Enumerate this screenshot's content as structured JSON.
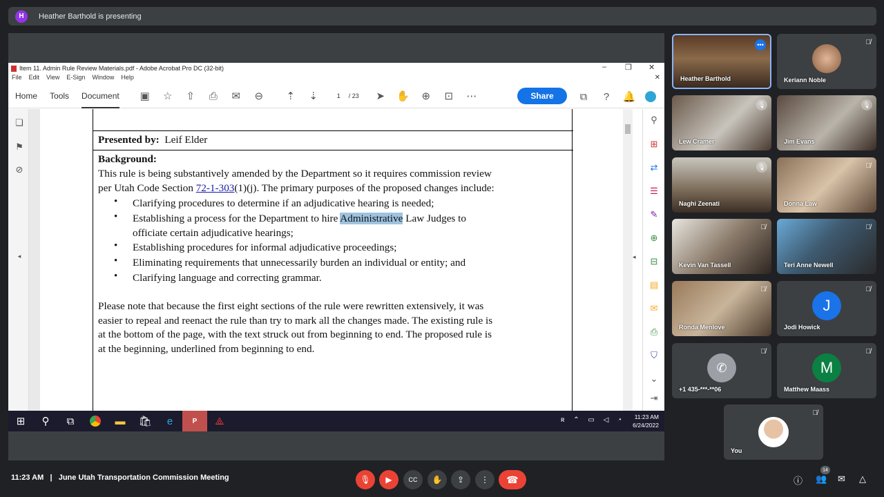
{
  "presenting_bar": {
    "avatar_letter": "H",
    "text": "Heather Barthold is presenting"
  },
  "acrobat": {
    "window_title": "Item 11. Admin Rule Review Materials.pdf - Adobe Acrobat Pro DC (32-bit)",
    "menu": [
      "File",
      "Edit",
      "View",
      "E-Sign",
      "Window",
      "Help"
    ],
    "tabs": [
      "Home",
      "Tools",
      "Document"
    ],
    "active_tab": "Document",
    "page_current": "1",
    "page_total": "/ 23",
    "share_label": "Share"
  },
  "document": {
    "presented_by_label": "Presented by:",
    "presented_by_name": "Leif Elder",
    "background_label": "Background:",
    "para1_line1": "This rule is being substantively amended by the Department so it requires commission review",
    "para1_line2_pre": "per Utah Code Section ",
    "para1_link": "72-1-303",
    "para1_line2_post": "(1)(j). The primary purposes of the proposed changes include:",
    "bullet1": "Clarifying procedures to determine if an adjudicative hearing is needed;",
    "bullet2_pre": "Establishing a process for the Department to hire ",
    "bullet2_hl": "Administrative",
    "bullet2_post": " Law Judges to",
    "bullet2_cont": "officiate certain adjudicative hearings;",
    "bullet3": "Establishing procedures for informal adjudicative proceedings;",
    "bullet4": "Eliminating requirements that unnecessarily burden an individual or entity; and",
    "bullet5": "Clarifying language and correcting grammar.",
    "para2_line1": "Please note that because the first eight sections of the rule were rewritten extensively, it was",
    "para2_line2": "easier to repeal and reenact the rule than try to mark all the changes made. The existing rule is",
    "para2_line3": "at the bottom of the page, with the text struck out from beginning to end.  The proposed rule is",
    "para2_line4": "at the beginning, underlined from beginning to end."
  },
  "taskbar": {
    "time": "11:23 AM",
    "date": "6/24/2022"
  },
  "participants": [
    {
      "name": "Heather Barthold",
      "more": "•••"
    },
    {
      "name": "Keriann Noble"
    },
    {
      "name": "Lew Cramer"
    },
    {
      "name": "Jim Evans"
    },
    {
      "name": "Naghi Zeenati"
    },
    {
      "name": "Donna Law"
    },
    {
      "name": "Kevin Van Tassell"
    },
    {
      "name": "Teri Anne Newell"
    },
    {
      "name": "Ronda Menlove"
    },
    {
      "name": "Jodi Howick",
      "initial": "J"
    },
    {
      "name": "+1 435-***-**06"
    },
    {
      "name": "Matthew Maass",
      "initial": "M"
    },
    {
      "name": "You"
    }
  ],
  "meeting": {
    "time": "11:23 AM",
    "separator": "|",
    "title": "June Utah Transportation Commission Meeting",
    "people_count": "14"
  },
  "colors": {
    "end_call": "#ea4335",
    "share": "#1473e6",
    "jodi_avatar": "#1a73e8",
    "matthew_avatar": "#0b8043"
  }
}
